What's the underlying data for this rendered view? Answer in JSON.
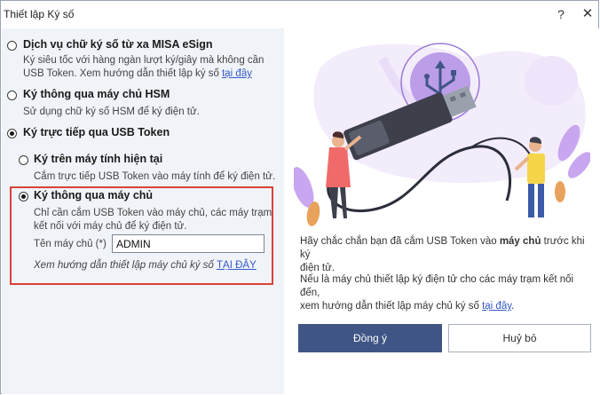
{
  "window": {
    "title": "Thiết lập Ký số",
    "help_glyph": "?",
    "close_glyph": "✕"
  },
  "options": {
    "misa": {
      "label": "Dịch vụ chữ ký số từ xa MISA eSign",
      "desc_line1": "Ký siêu tốc với hàng ngàn lượt ký/giây mà không cần",
      "desc_line2": "USB Token. Xem hướng dẫn thiết lập ký số ",
      "link": "tại đây",
      "checked": false
    },
    "hsm": {
      "label": "Ký thông qua máy chủ HSM",
      "desc": "Sử dụng chữ ký số HSM để ký điện tử.",
      "checked": false
    },
    "usb": {
      "label": "Ký trực tiếp qua USB Token",
      "checked": true,
      "sub_current": {
        "label": "Ký trên máy tính hiện tại",
        "desc": "Cắm trực tiếp USB Token vào máy tính để ký điện tử.",
        "checked": false
      },
      "sub_server": {
        "label": "Ký thông qua máy chủ",
        "desc_line1": "Chỉ cần cắm USB Token vào máy chủ, các máy trạm",
        "desc_line2": "kết nối với máy chủ để ký điện tử.",
        "checked": true,
        "server_label": "Tên máy chủ (*)",
        "server_value": "ADMIN",
        "guide_text": "Xem hướng dẫn thiết lập máy chủ ký số ",
        "guide_link": "TẠI ĐÂY"
      }
    }
  },
  "right": {
    "note1_prefix": "Hãy chắc chắn bạn đã cắm USB Token vào ",
    "note1_bold": "máy chủ",
    "note1_suffix": " trước khi ký",
    "note1_line2": "điện tử.",
    "note2_line1": "Nếu là máy chủ thiết lập ký điện tử cho các máy trạm kết nối đến,",
    "note2_line2": "xem hướng dẫn thiết lập máy chủ ký số ",
    "note2_link": "tại đây",
    "note2_end": "."
  },
  "buttons": {
    "ok": "Đồng ý",
    "cancel": "Huỷ bỏ"
  },
  "colors": {
    "accent": "#3f5585",
    "highlight_border": "#d9423b",
    "link": "#3559c9",
    "left_panel_bg": "#f0f3f8"
  }
}
